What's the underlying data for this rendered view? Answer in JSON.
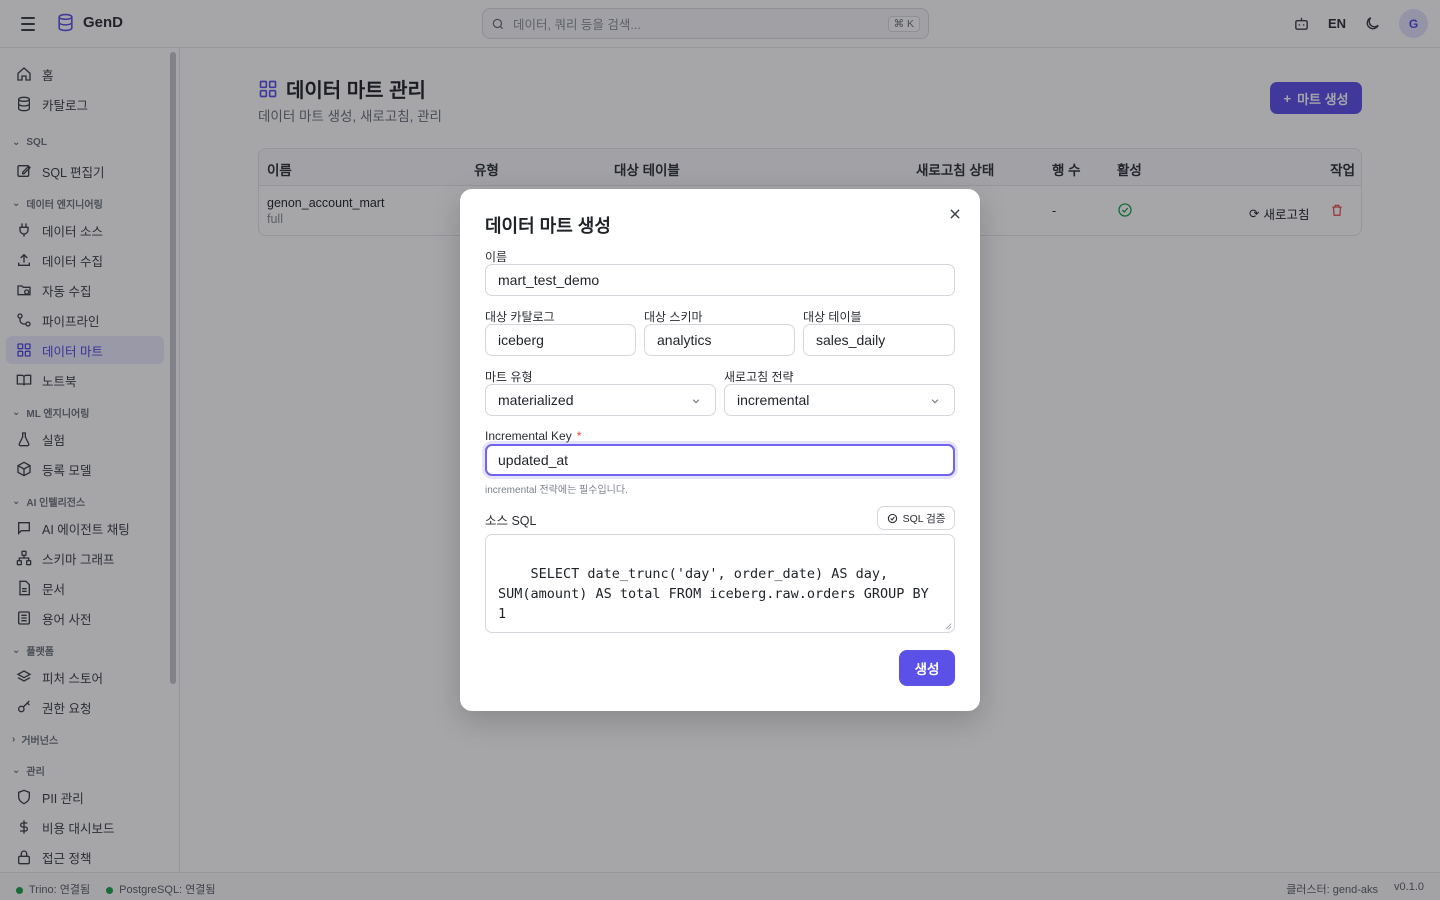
{
  "app": {
    "name": "GenD"
  },
  "header": {
    "search_placeholder": "데이터, 쿼리 등을 검색...",
    "shortcut": "⌘ K",
    "language": "EN",
    "avatar_initial": "G"
  },
  "sidebar": {
    "top_items": [
      {
        "label": "홈",
        "icon": "home-icon"
      },
      {
        "label": "카탈로그",
        "icon": "database-icon"
      }
    ],
    "sections": [
      {
        "title": "SQL",
        "items": [
          {
            "label": "SQL 편집기",
            "icon": "edit-icon"
          }
        ]
      },
      {
        "title": "데이터 엔지니어링",
        "items": [
          {
            "label": "데이터 소스",
            "icon": "plug-icon"
          },
          {
            "label": "데이터 수집",
            "icon": "upload-icon"
          },
          {
            "label": "자동 수집",
            "icon": "folder-clock-icon"
          },
          {
            "label": "파이프라인",
            "icon": "workflow-icon"
          },
          {
            "label": "데이터 마트",
            "icon": "grid-icon",
            "active": true
          },
          {
            "label": "노트북",
            "icon": "book-icon"
          }
        ]
      },
      {
        "title": "ML 엔지니어링",
        "items": [
          {
            "label": "실험",
            "icon": "flask-icon"
          },
          {
            "label": "등록 모델",
            "icon": "box-icon"
          }
        ]
      },
      {
        "title": "AI 인텔리전스",
        "items": [
          {
            "label": "AI 에이전트 채팅",
            "icon": "chat-icon"
          },
          {
            "label": "스키마 그래프",
            "icon": "network-icon"
          },
          {
            "label": "문서",
            "icon": "file-icon"
          },
          {
            "label": "용어 사전",
            "icon": "list-icon"
          }
        ]
      },
      {
        "title": "플랫폼",
        "items": [
          {
            "label": "피처 스토어",
            "icon": "layers-icon"
          },
          {
            "label": "권한 요청",
            "icon": "key-icon"
          }
        ]
      },
      {
        "title": "거버넌스",
        "collapsed": true,
        "items": []
      },
      {
        "title": "관리",
        "items": [
          {
            "label": "PII 관리",
            "icon": "shield-icon"
          },
          {
            "label": "비용 대시보드",
            "icon": "dollar-icon"
          },
          {
            "label": "접근 정책",
            "icon": "lock-icon"
          }
        ]
      }
    ]
  },
  "page": {
    "title": "데이터 마트 관리",
    "subtitle": "데이터 마트 생성, 새로고침, 관리",
    "create_button": "마트 생성"
  },
  "table": {
    "columns": [
      "이름",
      "유형",
      "대상 테이블",
      "새로고침 상태",
      "행 수",
      "활성",
      "작업"
    ],
    "rows": [
      {
        "name": "genon_account_mart",
        "sub": "full",
        "row_count": "-",
        "active": true,
        "refresh_label": "새로고침"
      }
    ]
  },
  "modal": {
    "title": "데이터 마트 생성",
    "fields": {
      "name": {
        "label": "이름",
        "value": "mart_test_demo"
      },
      "catalog": {
        "label": "대상 카탈로그",
        "value": "iceberg"
      },
      "schema": {
        "label": "대상 스키마",
        "value": "analytics"
      },
      "table": {
        "label": "대상 테이블",
        "value": "sales_daily"
      },
      "mart_type": {
        "label": "마트 유형",
        "value": "materialized"
      },
      "refresh_strategy": {
        "label": "새로고침 전략",
        "value": "incremental"
      },
      "incremental_key": {
        "label": "Incremental Key",
        "required_mark": "*",
        "value": "updated_at",
        "hint": "incremental 전략에는 필수입니다."
      },
      "source_sql": {
        "label": "소스 SQL",
        "validate_button": "SQL 검증",
        "value": "SELECT date_trunc('day', order_date) AS day, SUM(amount) AS total FROM iceberg.raw.orders GROUP BY 1"
      }
    },
    "submit_button": "생성"
  },
  "status": {
    "trino": "Trino: 연결됨",
    "postgres": "PostgreSQL: 연결됨",
    "cluster": "클러스터: gend-aks",
    "version": "v0.1.0",
    "connected_color": "#16a34a"
  },
  "colors": {
    "accent": "#5b50e8",
    "danger": "#e0453a",
    "success": "#16a34a"
  }
}
